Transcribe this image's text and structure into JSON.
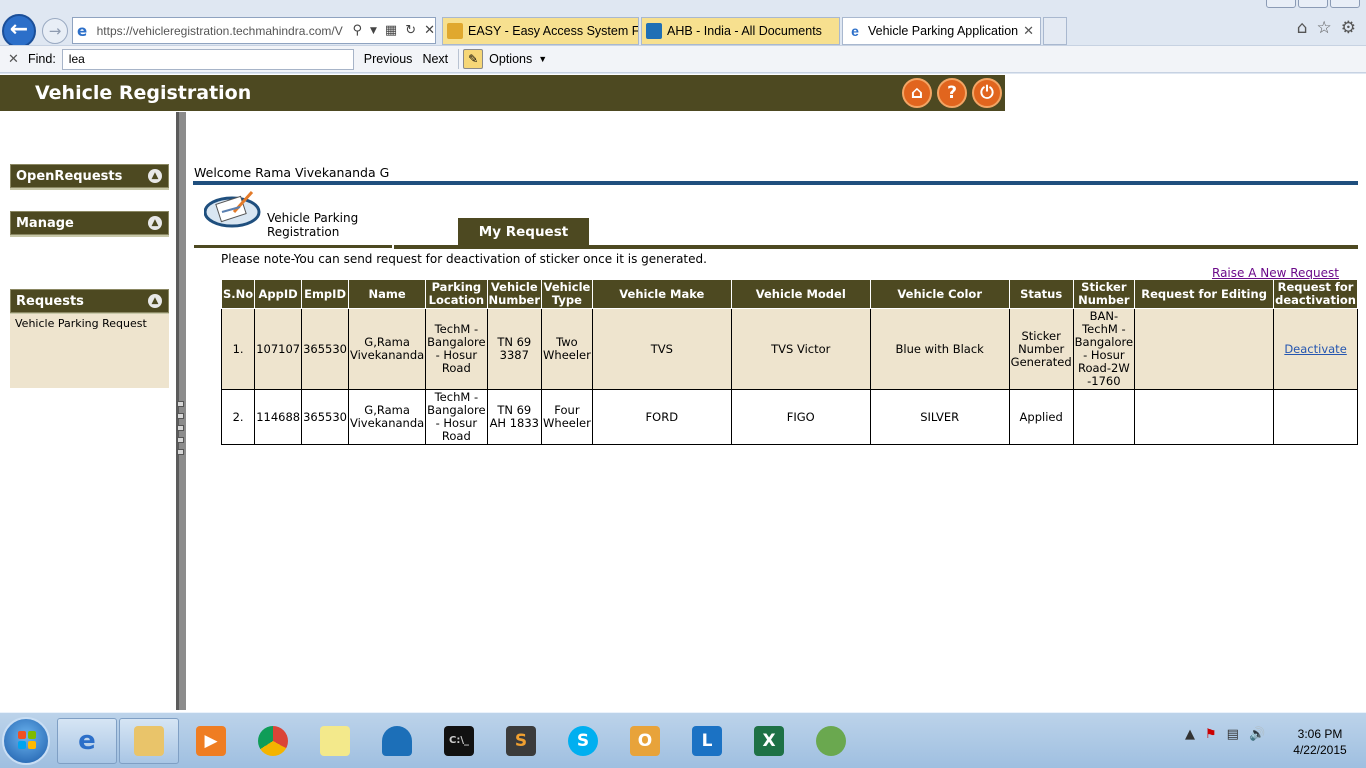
{
  "browser": {
    "url": "https://vehicleregistration.techmahindra.com/V",
    "tabs": [
      {
        "label": "EASY - Easy Access System For..."
      },
      {
        "label": "AHB - India - All Documents"
      },
      {
        "label": "Vehicle Parking Application"
      }
    ],
    "find": {
      "label": "Find:",
      "value": "lea",
      "previous": "Previous",
      "next": "Next",
      "options": "Options"
    }
  },
  "header": {
    "title": "Vehicle Registration",
    "icons": [
      "home-icon",
      "help-icon",
      "power-icon"
    ]
  },
  "sidebar": {
    "sections": [
      {
        "label": "OpenRequests"
      },
      {
        "label": "Manage"
      },
      {
        "label": "Requests",
        "items": [
          "Vehicle Parking Request"
        ]
      }
    ]
  },
  "main": {
    "welcome": "Welcome Rama Vivekananda G",
    "app_title_line1": "Vehicle Parking",
    "app_title_line2": "Registration",
    "tab_my_request": "My Request",
    "note": "Please note-You can send request for deactivation of sticker once it is generated.",
    "raise_link": "Raise A New Request",
    "table": {
      "headers": [
        "S.No",
        "AppID",
        "EmpID",
        "Name",
        "Parking Location",
        "Vehicle Number",
        "Vehicle Type",
        "Vehicle Make",
        "Vehicle Model",
        "Vehicle Color",
        "Status",
        "Sticker Number",
        "Request for Editing",
        "Request for deactivation"
      ],
      "rows": [
        {
          "sno": "1.",
          "appid": "107107",
          "empid": "365530",
          "name": "G,Rama Vivekananda",
          "location": "TechM - Bangalore - Hosur Road",
          "number": "TN 69 3387",
          "type": "Two Wheeler",
          "make": "TVS",
          "model": "TVS Victor",
          "color": "Blue with Black",
          "status": "Sticker Number Generated",
          "sticker": "BAN-TechM - Bangalore - Hosur Road-2W -1760",
          "editing": "",
          "deactivation": "Deactivate"
        },
        {
          "sno": "2.",
          "appid": "114688",
          "empid": "365530",
          "name": "G,Rama Vivekananda",
          "location": "TechM - Bangalore - Hosur Road",
          "number": "TN 69 AH 1833",
          "type": "Four Wheeler",
          "make": "FORD",
          "model": "FIGO",
          "color": "SILVER",
          "status": "Applied",
          "sticker": "",
          "editing": "",
          "deactivation": ""
        }
      ]
    }
  },
  "taskbar": {
    "apps": [
      "internet-explorer",
      "file-explorer",
      "media-player",
      "chrome",
      "sticky-notes",
      "wireshark",
      "command-prompt",
      "sublime-text",
      "skype",
      "outlook",
      "lync",
      "excel",
      "network"
    ],
    "time": "3:06 PM",
    "date": "4/22/2015"
  },
  "colors": {
    "olive": "#4d4921",
    "panel": "#eee4ce",
    "rule_blue": "#1f4f7e",
    "header_button": "#e1651e"
  }
}
